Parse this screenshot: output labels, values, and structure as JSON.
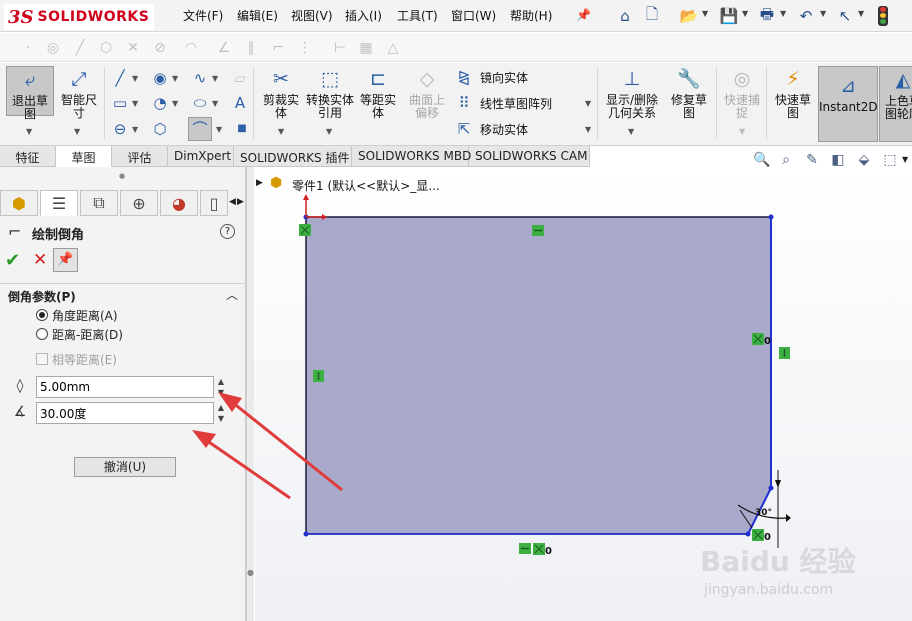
{
  "app": {
    "logo": "SOLIDWORKS"
  },
  "menu": [
    "文件(F)",
    "编辑(E)",
    "视图(V)",
    "插入(I)",
    "工具(T)",
    "窗口(W)",
    "帮助(H)"
  ],
  "quick_access_icons": [
    "home-icon",
    "new-document-icon",
    "open-icon",
    "save-icon",
    "print-icon",
    "undo-icon",
    "select-icon",
    "traffic-light-icon"
  ],
  "ribbon": {
    "exit_sketch": "退出草图",
    "smart_dimension": "智能尺寸",
    "trim": "剪裁实体",
    "convert": "转换实体引用",
    "offset": "等距实体",
    "surface_offset": "曲面上偏移",
    "mirror": "镜向实体",
    "linear_pattern": "线性草图阵列",
    "move": "移动实体",
    "display_relations": "显示/删除几何关系",
    "repair": "修复草图",
    "quick_snap": "快速捕捉",
    "rapid_sketch": "快速草图",
    "instant2d": "Instant2D",
    "shaded_contours": "上色草图轮廓"
  },
  "tabs": [
    "特征",
    "草图",
    "评估",
    "DimXpert",
    "SOLIDWORKS 插件",
    "SOLIDWORKS MBD",
    "SOLIDWORKS CAM"
  ],
  "active_tab": 1,
  "feature_tree": {
    "label": "零件1  (默认<<默认>_显..."
  },
  "property_manager": {
    "title": "绘制倒角",
    "section_title": "倒角参数(P)",
    "options": {
      "angle_distance": "角度距离(A)",
      "distance_distance": "距离-距离(D)",
      "equal_distance": "相等距离(E)"
    },
    "selected_option": "angle_distance",
    "distance_value": "5.00mm",
    "angle_value": "30.00度",
    "undo_button": "撤消(U)"
  },
  "sketch": {
    "dimension_label": "30°",
    "relation_marks": [
      "0",
      "0",
      "0"
    ]
  },
  "watermark": {
    "text": "Baidu 经验",
    "url": "jingyan.baidu.com"
  },
  "colors": {
    "sketch_fill": "#a9a9cc",
    "sketch_edge": "#1f2fd0",
    "relation_green": "#3cb043",
    "arrow_red": "#e03c3c",
    "logo_red": "#d0021b"
  }
}
